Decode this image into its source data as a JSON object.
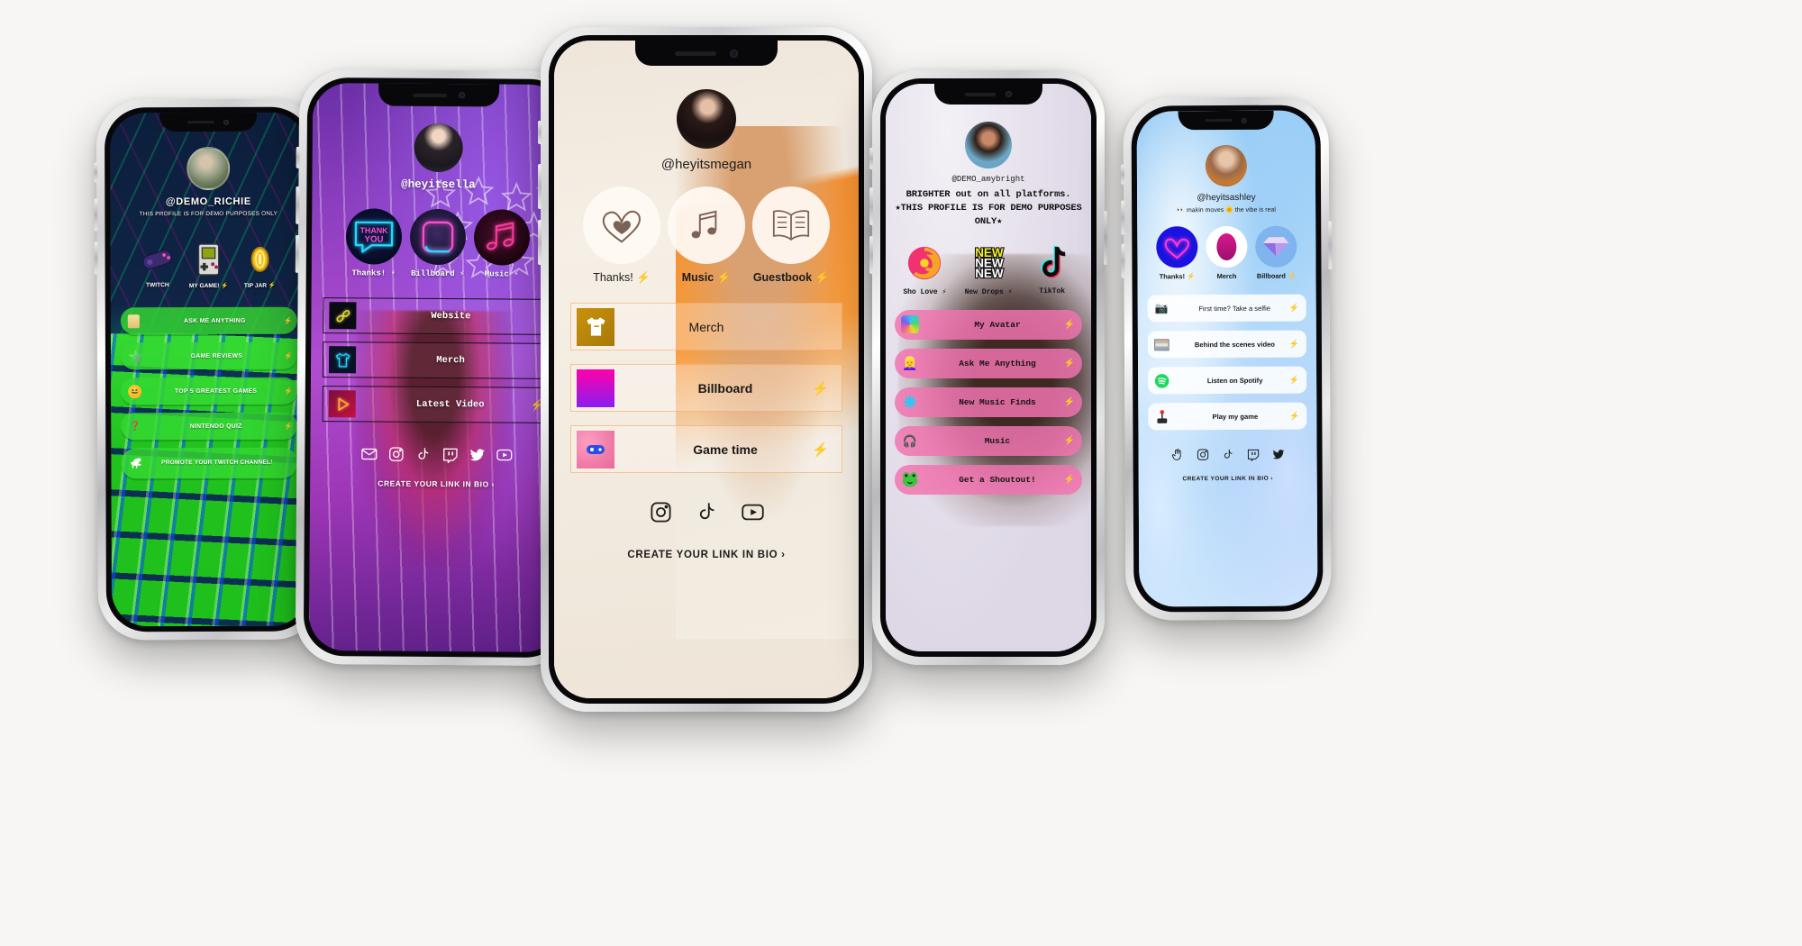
{
  "page": {
    "background": "#f7f6f4"
  },
  "phones": [
    {
      "id": "richie",
      "theme": {
        "accent": "#2ecc2a",
        "text": "#ffffff"
      },
      "handle": "@DEMO_RICHIE",
      "bio": "THIS PROFILE IS FOR DEMO PURPOSES ONLY",
      "icon_buttons": [
        {
          "label": "TWITCH",
          "bolt": false,
          "icon": "game-controller-icon"
        },
        {
          "label": "MY GAME!",
          "bolt": true,
          "icon": "gameboy-icon"
        },
        {
          "label": "TIP JAR",
          "bolt": true,
          "icon": "coin-icon"
        }
      ],
      "links": [
        {
          "label": "ASK ME ANYTHING",
          "bolt": true,
          "icon": "scroll-icon"
        },
        {
          "label": "GAME REVIEWS",
          "bolt": true,
          "icon": "rainbow-star-icon"
        },
        {
          "label": "TOP 5 GREATEST GAMES",
          "bolt": true,
          "icon": "laughing-emoji-icon"
        },
        {
          "label": "NINTENDO QUIZ",
          "bolt": true,
          "icon": "question-marks-icon"
        },
        {
          "label": "PROMOTE YOUR TWITCH CHANNEL!",
          "bolt": false,
          "icon": "dino-icon"
        }
      ]
    },
    {
      "id": "ella",
      "theme": {
        "accent": "#ff2fd0",
        "text": "#ffffff"
      },
      "handle": "@heyitsella",
      "bio": "",
      "icon_buttons": [
        {
          "label": "Thanks!",
          "bolt": true,
          "icon": "neon-thank-you-icon"
        },
        {
          "label": "Billboard",
          "bolt": true,
          "icon": "neon-square-icon"
        },
        {
          "label": "Music",
          "bolt": true,
          "icon": "neon-music-note-icon"
        }
      ],
      "links": [
        {
          "label": "Website",
          "bolt": false,
          "icon": "neon-link-icon"
        },
        {
          "label": "Merch",
          "bolt": false,
          "icon": "neon-tshirt-icon"
        },
        {
          "label": "Latest Video",
          "bolt": true,
          "icon": "neon-play-icon"
        }
      ],
      "socials": [
        "mail-icon",
        "instagram-icon",
        "tiktok-icon",
        "twitch-icon",
        "twitter-icon",
        "youtube-icon"
      ],
      "cta": "CREATE YOUR LINK IN BIO"
    },
    {
      "id": "megan",
      "theme": {
        "accent": "#f59132",
        "text": "#1b1b1b"
      },
      "handle": "@heyitsmegan",
      "bio": "",
      "icon_buttons": [
        {
          "label": "Thanks!",
          "bolt": true,
          "icon": "heart-outline-icon"
        },
        {
          "label": "Music",
          "bolt": true,
          "icon": "music-note-icon"
        },
        {
          "label": "Guestbook",
          "bolt": true,
          "icon": "open-book-icon"
        }
      ],
      "links": [
        {
          "label": "Merch",
          "bolt": false,
          "icon": "tshirt-thumb-icon"
        },
        {
          "label": "Billboard",
          "bolt": true,
          "icon": "gradient-thumb-icon"
        },
        {
          "label": "Game time",
          "bolt": true,
          "icon": "controller-thumb-icon"
        }
      ],
      "socials": [
        "instagram-icon",
        "tiktok-icon",
        "youtube-icon"
      ],
      "cta": "CREATE YOUR LINK IN BIO"
    },
    {
      "id": "amybright",
      "theme": {
        "accent": "#f06bb0",
        "text": "#1b1b1b"
      },
      "handle": "@DEMO_amybright",
      "bio": "BRIGHTER out on all platforms. ★THIS PROFILE IS FOR DEMO PURPOSES ONLY★",
      "icon_buttons": [
        {
          "label": "Sho Love",
          "bolt": true,
          "icon": "lollipop-swirl-icon"
        },
        {
          "label": "New Drops",
          "bolt": true,
          "icon": "new-new-new-icon"
        },
        {
          "label": "TikTok",
          "bolt": false,
          "icon": "tiktok-icon"
        }
      ],
      "links": [
        {
          "label": "My Avatar",
          "bolt": true,
          "icon": "avatar-blob-icon"
        },
        {
          "label": "Ask Me Anything",
          "bolt": true,
          "icon": "blonde-woman-emoji-icon"
        },
        {
          "label": "New Music Finds",
          "bolt": true,
          "icon": "splash-icon"
        },
        {
          "label": "Music",
          "bolt": true,
          "icon": "headphones-icon"
        },
        {
          "label": "Get a Shoutout!",
          "bolt": true,
          "icon": "frog-icon"
        }
      ]
    },
    {
      "id": "ashley",
      "theme": {
        "accent": "#2f7fe0",
        "text": "#1b1b1b"
      },
      "handle": "@heyitsashley",
      "bio": "👀 makin moves 🌞 the vibe is real",
      "icon_buttons": [
        {
          "label": "Thanks!",
          "bolt": true,
          "icon": "neon-heart-icon"
        },
        {
          "label": "Merch",
          "bolt": false,
          "icon": "magenta-oval-icon"
        },
        {
          "label": "Billboard",
          "bolt": true,
          "icon": "diamond-icon"
        }
      ],
      "links": [
        {
          "label": "First time? Take a selfie",
          "bolt": true,
          "icon": "camera-icon"
        },
        {
          "label": "Behind the scenes video",
          "bolt": true,
          "icon": "film-frames-icon"
        },
        {
          "label": "Listen on Spotify",
          "bolt": true,
          "icon": "spotify-icon"
        },
        {
          "label": "Play my game",
          "bolt": true,
          "icon": "joystick-icon"
        }
      ],
      "socials": [
        "wave-hand-icon",
        "instagram-icon",
        "tiktok-icon",
        "twitch-icon",
        "twitter-icon"
      ],
      "cta": "CREATE YOUR LINK IN BIO"
    }
  ]
}
